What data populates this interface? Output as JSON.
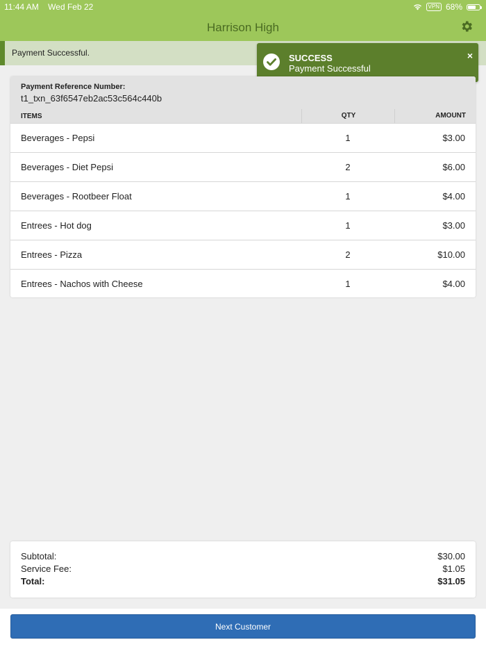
{
  "status_bar": {
    "time": "11:44 AM",
    "date": "Wed Feb 22",
    "vpn": "VPN",
    "battery": "68%",
    "battery_level": 0.68
  },
  "header": {
    "title": "Harrison High",
    "settings_icon": "gear-icon"
  },
  "banner": {
    "text": "Payment Successful."
  },
  "toast": {
    "title": "SUCCESS",
    "message": "Payment Successful",
    "close": "×",
    "color": "#5c7f2c"
  },
  "receipt": {
    "reference_label": "Payment Reference Number:",
    "reference_value": "t1_txn_63f6547eb2ac53c564c440b",
    "columns": {
      "items": "ITEMS",
      "qty": "QTY",
      "amount": "AMOUNT"
    },
    "rows": [
      {
        "name": "Beverages - Pepsi",
        "qty": "1",
        "amount": "$3.00"
      },
      {
        "name": "Beverages - Diet Pepsi",
        "qty": "2",
        "amount": "$6.00"
      },
      {
        "name": "Beverages - Rootbeer Float",
        "qty": "1",
        "amount": "$4.00"
      },
      {
        "name": "Entrees - Hot dog",
        "qty": "1",
        "amount": "$3.00"
      },
      {
        "name": "Entrees - Pizza",
        "qty": "2",
        "amount": "$10.00"
      },
      {
        "name": "Entrees - Nachos with Cheese",
        "qty": "1",
        "amount": "$4.00"
      }
    ]
  },
  "totals": {
    "subtotal_label": "Subtotal:",
    "subtotal_value": "$30.00",
    "fee_label": "Service Fee:",
    "fee_value": "$1.05",
    "total_label": "Total:",
    "total_value": "$31.05"
  },
  "actions": {
    "next_label": "Next Customer",
    "accent": "#2f6db5"
  }
}
